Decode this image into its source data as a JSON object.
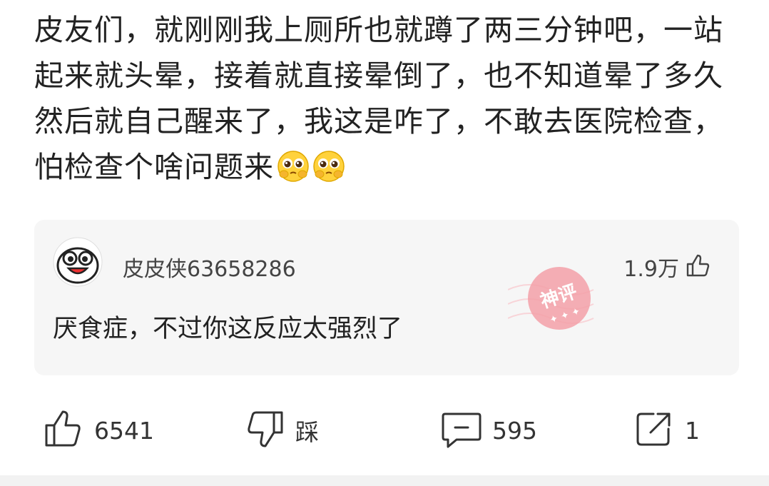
{
  "post": {
    "text": "皮友们，就刚刚我上厕所也就蹲了两三分钟吧，一站起来就头晕，接着就直接晕倒了，也不知道晕了多久然后就自己醒来了，我这是咋了，不敢去医院检查，怕检查个啥问题来",
    "emojis": [
      "pleading-face-icon",
      "pleading-face-icon"
    ]
  },
  "comment": {
    "username": "皮皮侠63658286",
    "like_count": "1.9万",
    "text": "厌食症，不过你这反应太强烈了",
    "badge": "神评"
  },
  "actions": {
    "like_count": "6541",
    "dislike_label": "踩",
    "comment_count": "595",
    "share_count": "1"
  },
  "colors": {
    "badge": "#f3a0a8",
    "comment_bg": "#f6f6f6"
  }
}
